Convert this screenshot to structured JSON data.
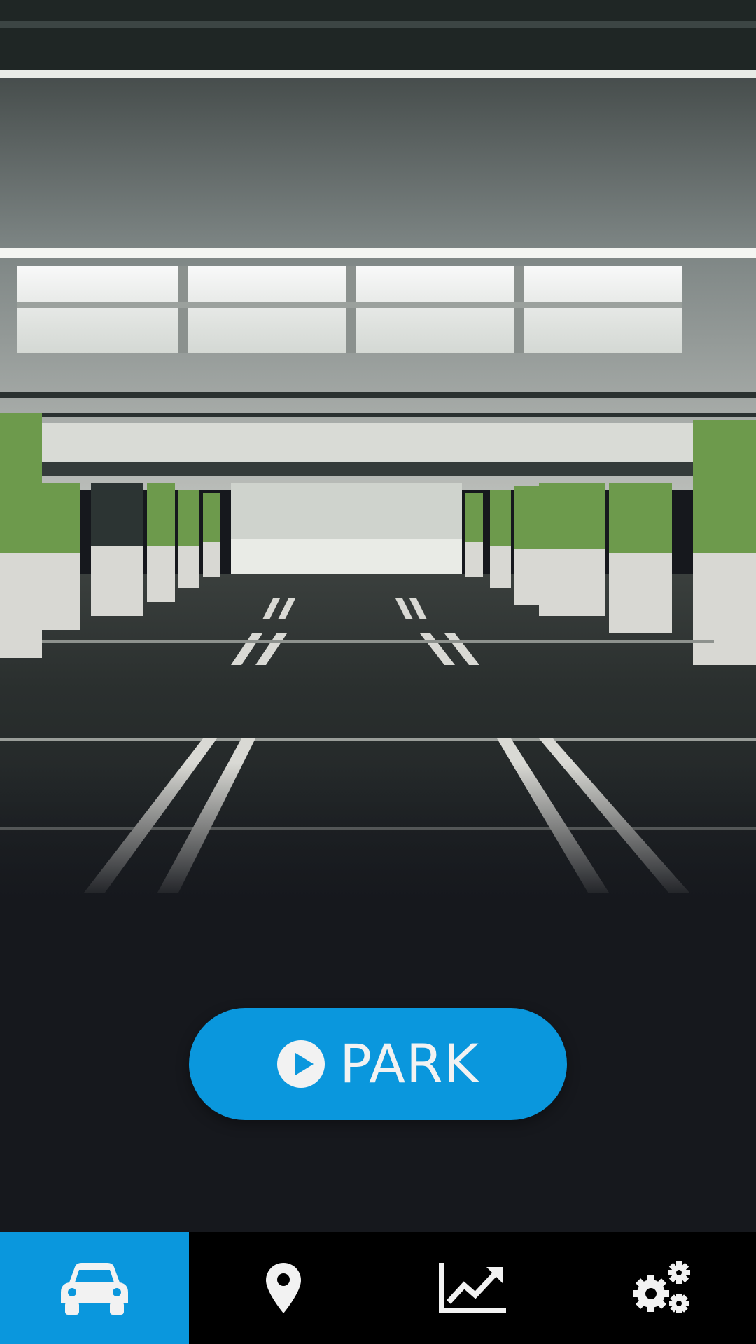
{
  "park_button": {
    "label": "PARK",
    "icon": "play-circle-icon"
  },
  "hero": {
    "description_icon": "parking-garage-photo"
  },
  "nav": {
    "active_index": 0,
    "tabs": [
      {
        "name": "car",
        "icon": "car-icon"
      },
      {
        "name": "location",
        "icon": "map-marker-icon"
      },
      {
        "name": "stats",
        "icon": "line-chart-icon"
      },
      {
        "name": "settings",
        "icon": "gears-icon"
      }
    ]
  },
  "colors": {
    "accent": "#0a97dd",
    "background": "#16181d",
    "tabbar": "#000000",
    "icon": "#f2f2f2"
  }
}
